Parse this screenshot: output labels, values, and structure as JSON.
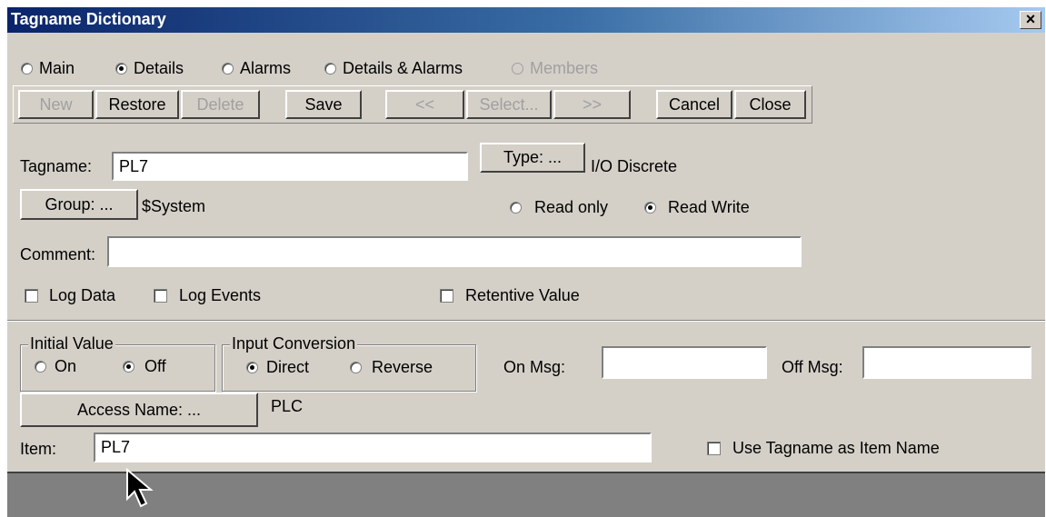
{
  "window": {
    "title": "Tagname Dictionary",
    "close_label": "×"
  },
  "view_modes": [
    {
      "label": "Main",
      "selected": false,
      "enabled": true
    },
    {
      "label": "Details",
      "selected": true,
      "enabled": true
    },
    {
      "label": "Alarms",
      "selected": false,
      "enabled": true
    },
    {
      "label": "Details & Alarms",
      "selected": false,
      "enabled": true
    },
    {
      "label": "Members",
      "selected": false,
      "enabled": false
    }
  ],
  "toolbar": {
    "new_label": "New",
    "restore_label": "Restore",
    "delete_label": "Delete",
    "save_label": "Save",
    "prev_label": "<<",
    "select_label": "Select...",
    "next_label": ">>",
    "cancel_label": "Cancel",
    "close_label": "Close"
  },
  "details": {
    "tagname_label": "Tagname:",
    "tagname_value": "PL7",
    "type_button_label": "Type: ...",
    "type_value": "I/O Discrete",
    "group_button_label": "Group: ...",
    "group_value": "$System",
    "access": {
      "read_only_label": "Read only",
      "read_write_label": "Read Write",
      "selected": "Read Write"
    },
    "comment_label": "Comment:",
    "comment_value": "",
    "log_data_label": "Log Data",
    "log_data_checked": false,
    "log_events_label": "Log Events",
    "log_events_checked": false,
    "retentive_label": "Retentive Value",
    "retentive_checked": false
  },
  "io": {
    "initial_value_legend": "Initial Value",
    "initial_on_label": "On",
    "initial_off_label": "Off",
    "initial_selected": "Off",
    "input_conversion_legend": "Input Conversion",
    "direct_label": "Direct",
    "reverse_label": "Reverse",
    "conversion_selected": "Direct",
    "on_msg_label": "On Msg:",
    "on_msg_value": "",
    "off_msg_label": "Off Msg:",
    "off_msg_value": "",
    "access_name_button_label": "Access Name: ...",
    "access_name_value": "PLC",
    "item_label": "Item:",
    "item_value": "PL7",
    "use_tagname_label": "Use Tagname as Item Name",
    "use_tagname_checked": false
  }
}
